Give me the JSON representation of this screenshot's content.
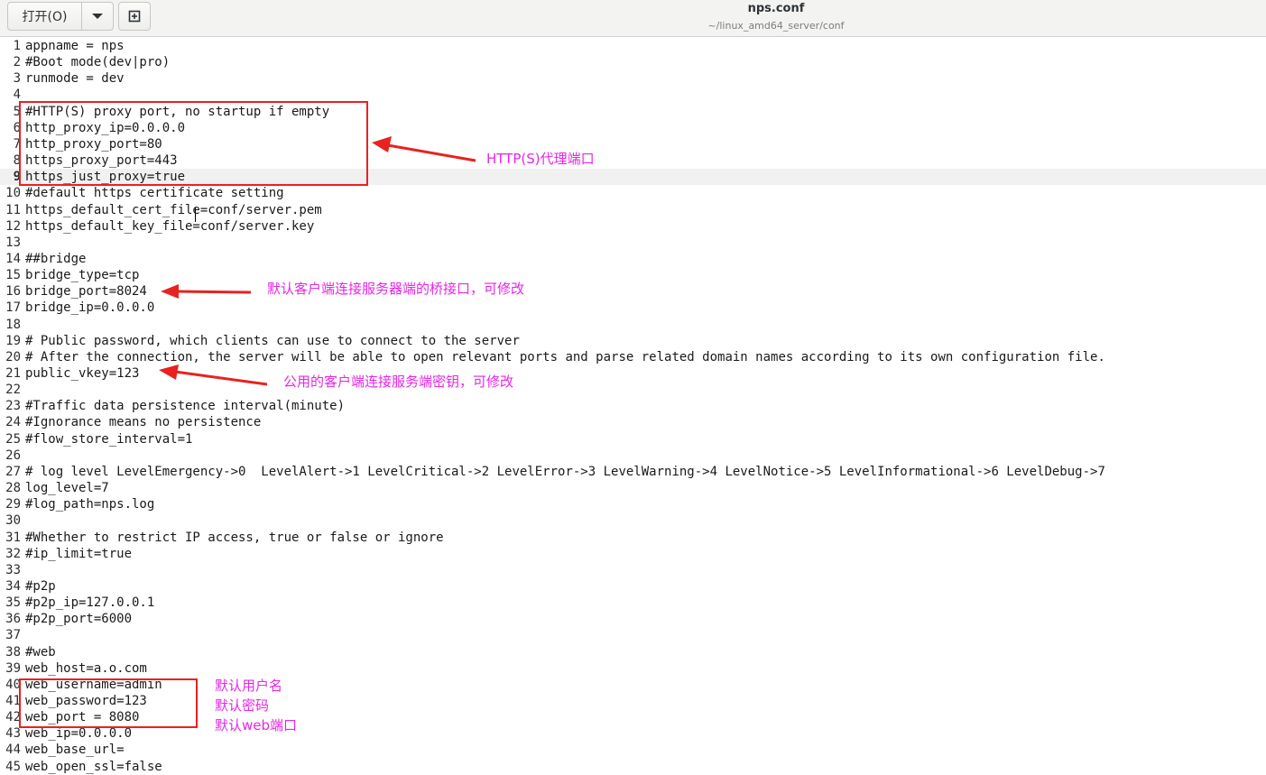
{
  "toolbar": {
    "open_label": "打开(O)",
    "dropdown_icon": "chevron-down-icon",
    "new_document_icon": "new-document-icon"
  },
  "header": {
    "title": "nps.conf",
    "subtitle": "~/linux_amd64_server/conf"
  },
  "editor": {
    "current_line": 9,
    "lines": [
      {
        "num": "1",
        "text": "appname = nps"
      },
      {
        "num": "2",
        "text": "#Boot mode(dev|pro)"
      },
      {
        "num": "3",
        "text": "runmode = dev"
      },
      {
        "num": "4",
        "text": ""
      },
      {
        "num": "5",
        "text": "#HTTP(S) proxy port, no startup if empty"
      },
      {
        "num": "6",
        "text": "http_proxy_ip=0.0.0.0"
      },
      {
        "num": "7",
        "text": "http_proxy_port=80"
      },
      {
        "num": "8",
        "text": "https_proxy_port=443"
      },
      {
        "num": "9",
        "text": "https_just_proxy=true"
      },
      {
        "num": "10",
        "text": "#default https certificate setting"
      },
      {
        "num": "11",
        "text": "https_default_cert_file=conf/server.pem"
      },
      {
        "num": "12",
        "text": "https_default_key_file=conf/server.key"
      },
      {
        "num": "13",
        "text": ""
      },
      {
        "num": "14",
        "text": "##bridge"
      },
      {
        "num": "15",
        "text": "bridge_type=tcp"
      },
      {
        "num": "16",
        "text": "bridge_port=8024"
      },
      {
        "num": "17",
        "text": "bridge_ip=0.0.0.0"
      },
      {
        "num": "18",
        "text": ""
      },
      {
        "num": "19",
        "text": "# Public password, which clients can use to connect to the server"
      },
      {
        "num": "20",
        "text": "# After the connection, the server will be able to open relevant ports and parse related domain names according to its own configuration file."
      },
      {
        "num": "21",
        "text": "public_vkey=123"
      },
      {
        "num": "22",
        "text": ""
      },
      {
        "num": "23",
        "text": "#Traffic data persistence interval(minute)"
      },
      {
        "num": "24",
        "text": "#Ignorance means no persistence"
      },
      {
        "num": "25",
        "text": "#flow_store_interval=1"
      },
      {
        "num": "26",
        "text": ""
      },
      {
        "num": "27",
        "text": "# log level LevelEmergency->0  LevelAlert->1 LevelCritical->2 LevelError->3 LevelWarning->4 LevelNotice->5 LevelInformational->6 LevelDebug->7"
      },
      {
        "num": "28",
        "text": "log_level=7"
      },
      {
        "num": "29",
        "text": "#log_path=nps.log"
      },
      {
        "num": "30",
        "text": ""
      },
      {
        "num": "31",
        "text": "#Whether to restrict IP access, true or false or ignore"
      },
      {
        "num": "32",
        "text": "#ip_limit=true"
      },
      {
        "num": "33",
        "text": ""
      },
      {
        "num": "34",
        "text": "#p2p"
      },
      {
        "num": "35",
        "text": "#p2p_ip=127.0.0.1"
      },
      {
        "num": "36",
        "text": "#p2p_port=6000"
      },
      {
        "num": "37",
        "text": ""
      },
      {
        "num": "38",
        "text": "#web"
      },
      {
        "num": "39",
        "text": "web_host=a.o.com"
      },
      {
        "num": "40",
        "text": "web_username=admin"
      },
      {
        "num": "41",
        "text": "web_password=123"
      },
      {
        "num": "42",
        "text": "web_port = 8080"
      },
      {
        "num": "43",
        "text": "web_ip=0.0.0.0"
      },
      {
        "num": "44",
        "text": "web_base_url="
      },
      {
        "num": "45",
        "text": "web_open_ssl=false"
      }
    ]
  },
  "annotations": {
    "color": "#e626e6",
    "box_color": "#e8221f",
    "http_proxy_port": "HTTP(S)代理端口",
    "bridge_port": "默认客户端连接服务器端的桥接口，可修改",
    "public_vkey": "公用的客户端连接服务端密钥，可修改",
    "web_username": "默认用户名",
    "web_password": "默认密码",
    "web_port": "默认web端口"
  }
}
